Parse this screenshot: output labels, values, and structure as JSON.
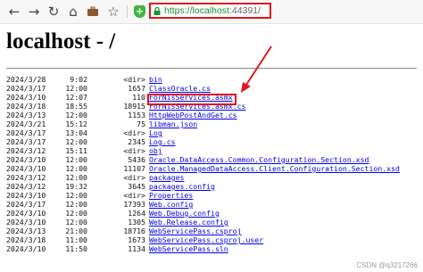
{
  "toolbar": {
    "icons": [
      "back-icon",
      "forward-icon",
      "reload-icon",
      "home-icon",
      "briefcase-icon",
      "bookmark-star-icon",
      "shield-icon",
      "lock-icon"
    ]
  },
  "address": {
    "scheme": "https://",
    "host": "localhost",
    "port": ":44391/"
  },
  "page": {
    "title": "localhost - /"
  },
  "listing": [
    {
      "date": "2024/3/28",
      "time": "9:02",
      "size": "<dir>",
      "name": "bin"
    },
    {
      "date": "2024/3/17",
      "time": "12:00",
      "size": "1657",
      "name": "ClassOracle.cs"
    },
    {
      "date": "2024/3/10",
      "time": "12:07",
      "size": "110",
      "name": "ForNisServices.asmx"
    },
    {
      "date": "2024/3/18",
      "time": "18:55",
      "size": "18915",
      "name": "ForNisServices.asmx.cs"
    },
    {
      "date": "2024/3/13",
      "time": "12:00",
      "size": "1153",
      "name": "HttpWebPostAndGet.cs"
    },
    {
      "date": "2024/3/21",
      "time": "15:12",
      "size": "75",
      "name": "libman.json"
    },
    {
      "date": "2024/3/17",
      "time": "13:04",
      "size": "<dir>",
      "name": "Log"
    },
    {
      "date": "2024/3/17",
      "time": "12:00",
      "size": "2345",
      "name": "Log.cs"
    },
    {
      "date": "2024/3/12",
      "time": "15:11",
      "size": "<dir>",
      "name": "obj"
    },
    {
      "date": "2024/3/10",
      "time": "12:00",
      "size": "5436",
      "name": "Oracle.DataAccess.Common.Configuration.Section.xsd"
    },
    {
      "date": "2024/3/10",
      "time": "12:00",
      "size": "11107",
      "name": "Oracle.ManagedDataAccess.Client.Configuration.Section.xsd"
    },
    {
      "date": "2024/3/12",
      "time": "12:00",
      "size": "<dir>",
      "name": "packages"
    },
    {
      "date": "2024/3/12",
      "time": "19:32",
      "size": "3645",
      "name": "packages.config"
    },
    {
      "date": "2024/3/10",
      "time": "12:00",
      "size": "<dir>",
      "name": "Properties"
    },
    {
      "date": "2024/3/17",
      "time": "12:00",
      "size": "17393",
      "name": "Web.config"
    },
    {
      "date": "2024/3/10",
      "time": "12:00",
      "size": "1264",
      "name": "Web.Debug.config"
    },
    {
      "date": "2024/3/10",
      "time": "12:00",
      "size": "1305",
      "name": "Web.Release.config"
    },
    {
      "date": "2024/3/13",
      "time": "21:00",
      "size": "18716",
      "name": "WebServicePass.csproj"
    },
    {
      "date": "2024/3/18",
      "time": "11:00",
      "size": "1673",
      "name": "WebServicePass.csproj.user"
    },
    {
      "date": "2024/3/10",
      "time": "11:50",
      "size": "1134",
      "name": "WebServicePass.sln"
    }
  ],
  "colors": {
    "highlight": "#e0161c",
    "link": "#0000ee",
    "host": "#1a8f2f"
  },
  "watermark": "CSDN @q3217266"
}
